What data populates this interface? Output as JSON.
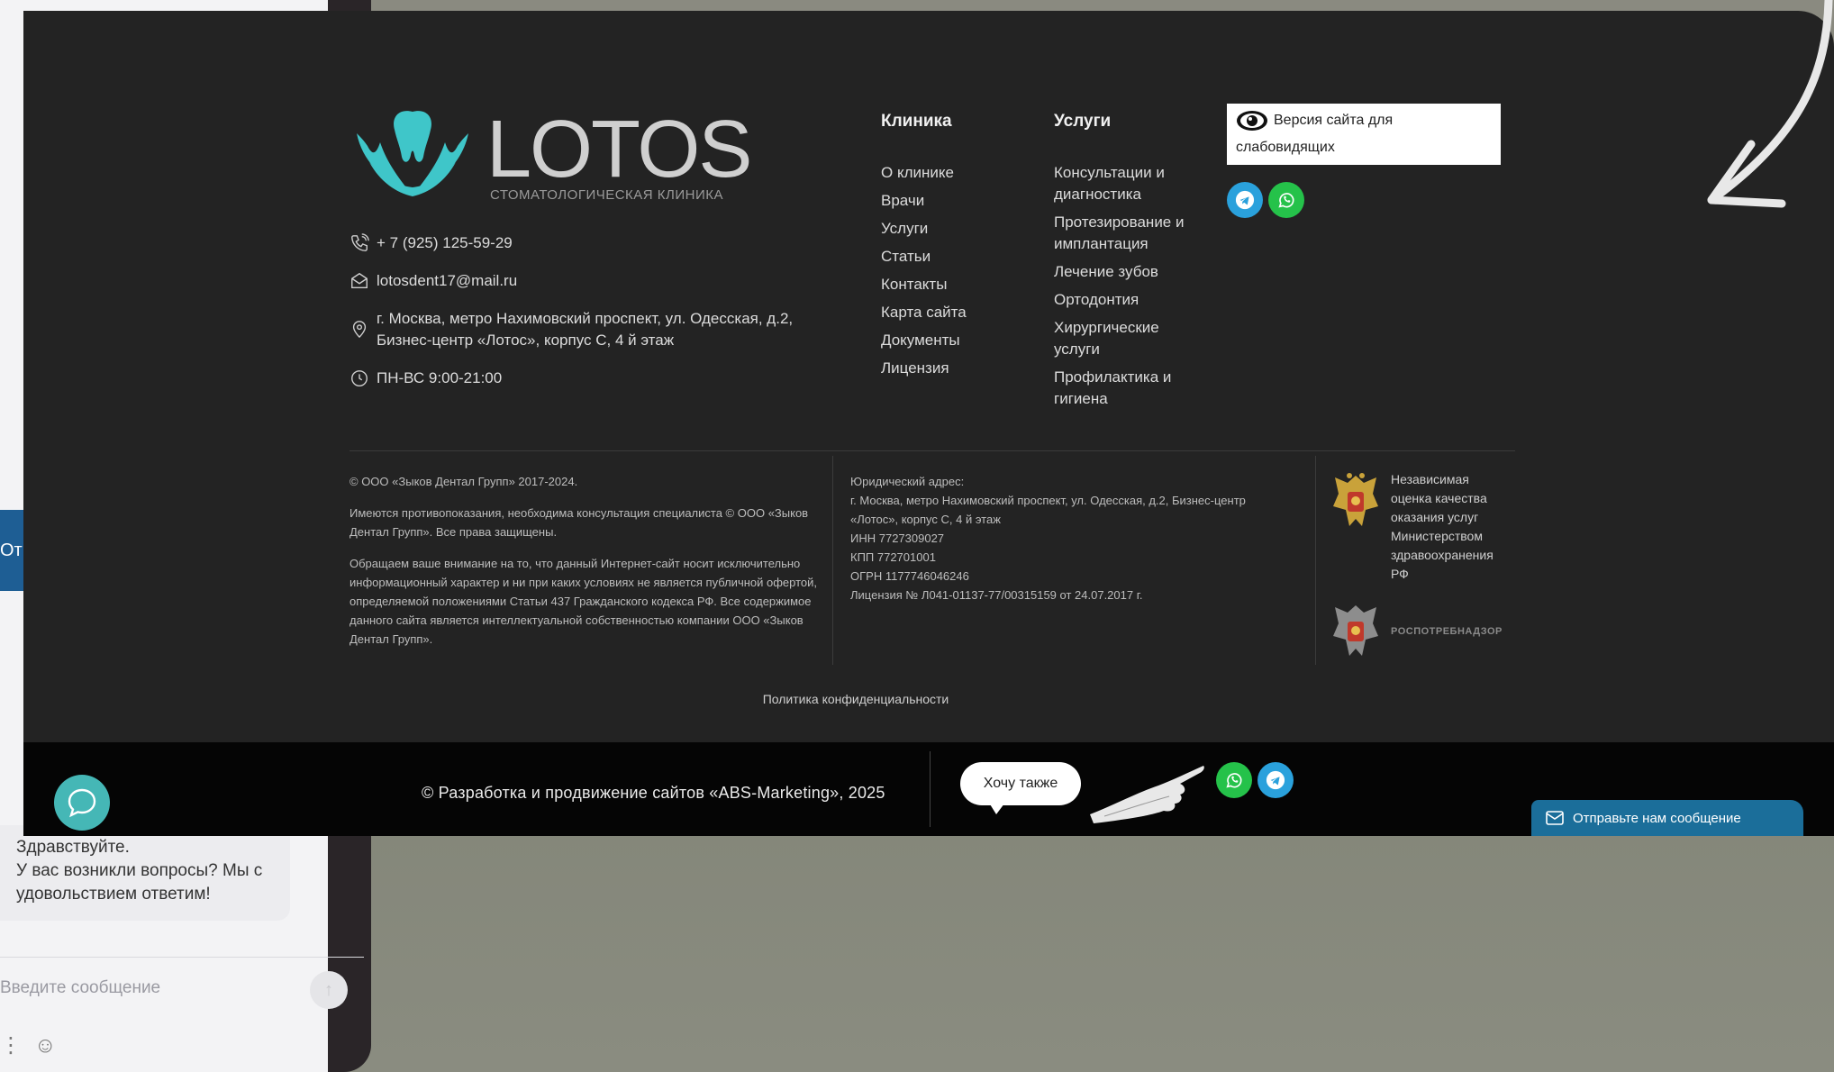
{
  "background_chat": {
    "tab_label": "От",
    "greeting_lines": [
      "Здравствуйте.",
      "У вас возникли вопросы? Мы с",
      "удовольствием ответим!"
    ],
    "input_placeholder": "Введите сообщение"
  },
  "logo": {
    "wordmark": "LOTOS",
    "subtitle": "СТОМАТОЛОГИЧЕСКАЯ КЛИНИКА",
    "mark_color": "#3fc6c9"
  },
  "contacts": {
    "phone": "+ 7 (925) 125-59-29",
    "email": "lotosdent17@mail.ru",
    "address_line1": "г. Москва, метро Нахимовский проспект, ул. Одесская, д.2,",
    "address_line2": "Бизнес-центр «Лотос», корпус С, 4 й этаж",
    "hours": "ПН-ВС 9:00-21:00"
  },
  "nav": {
    "clinic_title": "Клиника",
    "clinic_items": [
      "О клинике",
      "Врачи",
      "Услуги",
      "Статьи",
      "Контакты",
      "Карта сайта",
      "Документы",
      "Лицензия"
    ],
    "services_title": "Услуги",
    "services_items": [
      "Консультации и диагностика",
      "Протезирование и имплантация",
      "Лечение зубов",
      "Ортодонтия",
      "Хирургические услуги",
      "Профилактика и гигиена"
    ]
  },
  "accessibility": {
    "label_line1": "Версия сайта для",
    "label_line2": "слабовидящих"
  },
  "legal": {
    "copyright": "© ООО «Зыков Дентал Групп» 2017-2024.",
    "contraindications": "Имеются противопоказания, необходима консультация специалиста © ООО «Зыков Дентал Групп». Все права защищены.",
    "notice": "Обращаем ваше внимание на то, что данный Интернет-сайт носит исключительно информационный характер и ни при каких условиях не является публичной офертой, определяемой положениями Статьи 437 Гражданского кодекса РФ. Все содержимое данного сайта является интеллектуальной собственностью компании ООО «Зыков Дентал Групп».",
    "address_title": "Юридический адрес:",
    "address_text": "г. Москва, метро Нахимовский проспект, ул. Одесская, д.2, Бизнес-центр «Лотос», корпус С, 4 й этаж",
    "inn": "ИНН 7727309027",
    "kpp": "КПП 772701001",
    "ogrn": "ОГРН 1177746046246",
    "license": "Лицензия № Л041-01137-77/00315159 от 24.07.2017 г."
  },
  "badges": {
    "ministry": "Независимая оценка качества оказания услуг Министерством здравоохранения РФ",
    "rospotreb": "РОСПОТРЕБНАДЗОР"
  },
  "privacy_link": "Политика конфиденциальности",
  "dev_bar": {
    "credit": "© Разработка и продвижение сайтов «ABS-Marketing», 2025",
    "want_button": "Хочу также",
    "send_message": "Отправьте нам сообщение"
  },
  "colors": {
    "footer_bg": "#232323",
    "dev_bar_bg": "#050505",
    "telegram": "#2aa1dc",
    "whatsapp": "#25c24a",
    "chat_fab": "#45b7b6",
    "send_btn": "#1b6e9a"
  }
}
